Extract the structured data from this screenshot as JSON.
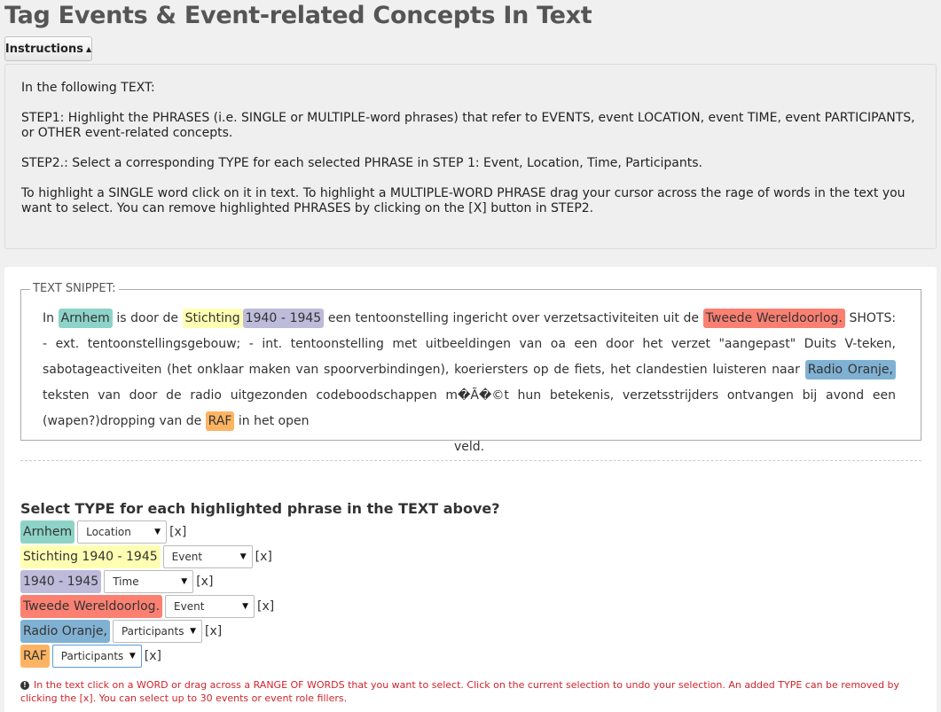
{
  "page": {
    "title": "Tag Events & Event-related Concepts In Text",
    "instructions_button": "Instructions"
  },
  "instructions": {
    "p1": "In the following TEXT:",
    "p2": "STEP1: Highlight the PHRASES (i.e. SINGLE or MULTIPLE-word phrases) that refer to EVENTS, event LOCATION, event TIME, event PARTICIPANTS, or OTHER event-related concepts.",
    "p3": "STEP2.: Select a corresponding TYPE for each selected PHRASE in STEP 1: Event, Location, Time, Participants.",
    "p4": "To highlight a SINGLE word click on it in text. To highlight a MULTIPLE-WORD PHRASE drag your cursor across the rage of words in the text you want to select. You can remove highlighted PHRASES by clicking on the [X] button in STEP2."
  },
  "snippet": {
    "legend": "TEXT SNIPPET:",
    "t0": "In",
    "h_arnhem": "Arnhem",
    "t1": "is door de",
    "h_stichting": "Stichting",
    "h_years": "1940 - 1945",
    "t2": "een tentoonstelling ingericht over verzetsactiviteiten uit de",
    "h_tweede": "Tweede Wereldoorlog.",
    "t3": "SHOTS: - ext. tentoonstellingsgebouw; - int. tentoonstelling met uitbeeldingen van oa een door het verzet \"aangepast\" Duits V-teken, sabotageactiveiten (het onklaar maken van spoorverbindingen), koeriersters op de fiets, het clandestien luisteren naar",
    "h_radio": "Radio Oranje,",
    "t4": "teksten van door de radio uitgezonden codeboodschappen m�Ã�©t hun betekenis, verzetsstrijders ontvangen bij avond een (wapen?)dropping van de",
    "h_raf": "RAF",
    "t5": "in het open",
    "t6": "veld."
  },
  "types_section": {
    "title": "Select TYPE for each highlighted phrase in the TEXT above?",
    "remove_label": "[x]",
    "rows": [
      {
        "phrase": "Arnhem",
        "type": "Location",
        "color": "#8dd3c7"
      },
      {
        "phrase": "Stichting 1940 - 1945",
        "type": "Event",
        "color": "#ffffb3"
      },
      {
        "phrase": "1940 - 1945",
        "type": "Time",
        "color": "#bebada"
      },
      {
        "phrase": "Tweede Wereldoorlog.",
        "type": "Event",
        "color": "#fb8072"
      },
      {
        "phrase": "Radio Oranje,",
        "type": "Participants",
        "color": "#80b1d3"
      },
      {
        "phrase": "RAF",
        "type": "Participants",
        "color": "#fdb462"
      }
    ]
  },
  "note": {
    "icon": "info-icon",
    "text": "In the text click on a WORD or drag across a RANGE OF WORDS that you want to select. Click on the current selection to undo your selection. An added TYPE can be removed by clicking the [x]. You can select up to 30 events or event role fillers."
  }
}
